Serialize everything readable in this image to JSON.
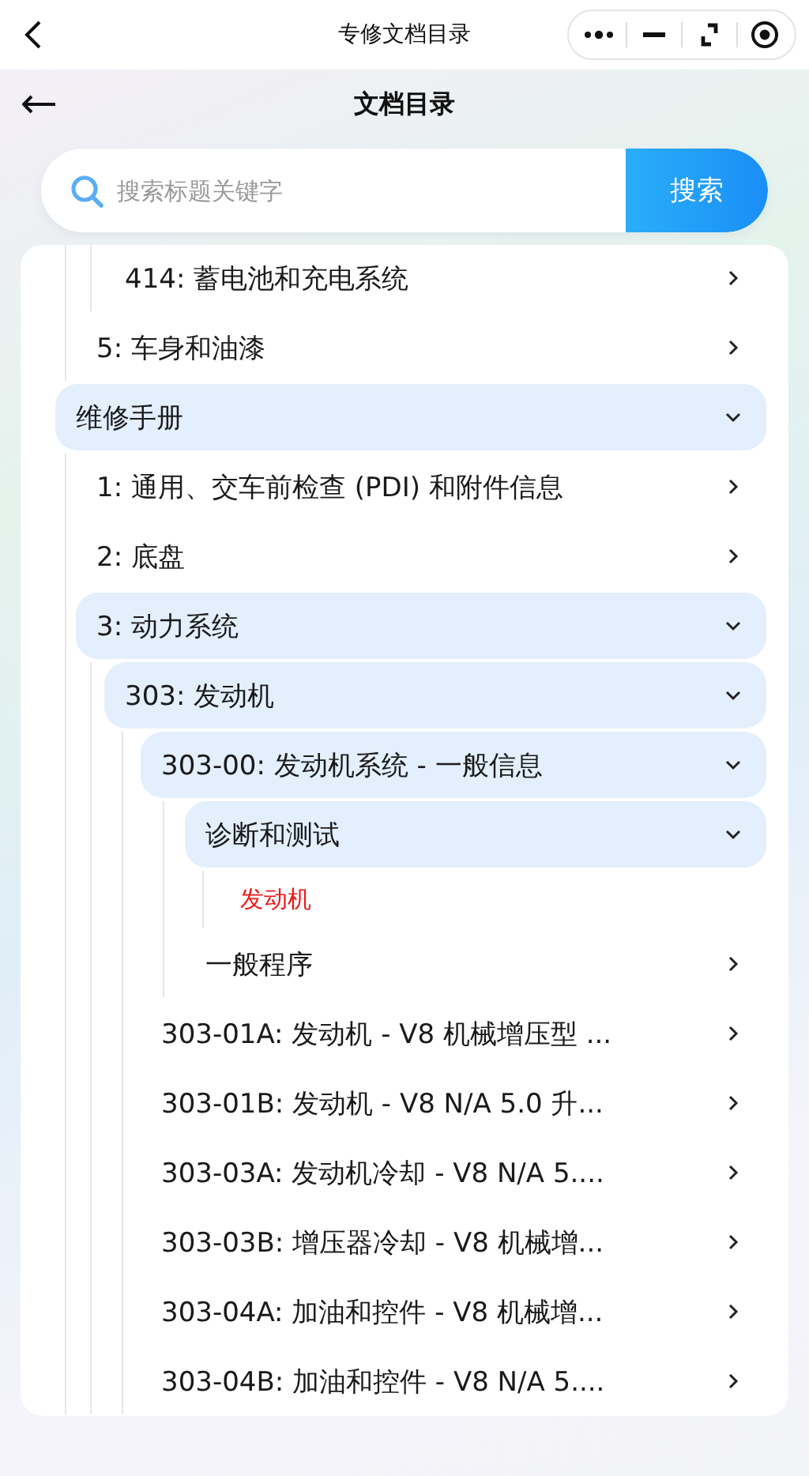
{
  "top_bar": {
    "title": "专修文档目录"
  },
  "header": {
    "title": "文档目录"
  },
  "search": {
    "placeholder": "搜索标题关键字",
    "button": "搜索"
  },
  "tree": [
    {
      "children": [
        {
          "children": [
            {
              "label": "414: 蓄电池和充电系统",
              "expanded": false,
              "selected": false
            }
          ]
        },
        {
          "label": "5: 车身和油漆",
          "expanded": false,
          "selected": false
        }
      ]
    },
    {
      "label": "维修手册",
      "expanded": true,
      "selected": false,
      "children": [
        {
          "label": "1: 通用、交车前检查 (PDI) 和附件信息",
          "expanded": false,
          "selected": false
        },
        {
          "label": "2: 底盘",
          "expanded": false,
          "selected": false
        },
        {
          "label": "3: 动力系统",
          "expanded": true,
          "selected": false,
          "children": [
            {
              "label": "303: 发动机",
              "expanded": true,
              "selected": false,
              "children": [
                {
                  "label": "303-00: 发动机系统 - 一般信息",
                  "expanded": true,
                  "selected": false,
                  "children": [
                    {
                      "label": "诊断和测试",
                      "expanded": true,
                      "selected": false,
                      "children": [
                        {
                          "label": "发动机",
                          "selected": true
                        }
                      ]
                    },
                    {
                      "label": "一般程序",
                      "expanded": false,
                      "selected": false
                    }
                  ]
                },
                {
                  "label": "303-01A: 发动机 - V8 机械增压型 ...",
                  "expanded": false,
                  "selected": false
                },
                {
                  "label": "303-01B: 发动机 - V8 N/A 5.0 升...",
                  "expanded": false,
                  "selected": false
                },
                {
                  "label": "303-03A: 发动机冷却 - V8 N/A 5....",
                  "expanded": false,
                  "selected": false
                },
                {
                  "label": "303-03B: 增压器冷却 - V8 机械增...",
                  "expanded": false,
                  "selected": false
                },
                {
                  "label": "303-04A: 加油和控件 - V8 机械增...",
                  "expanded": false,
                  "selected": false
                },
                {
                  "label": "303-04B: 加油和控件 - V8 N/A 5....",
                  "expanded": false,
                  "selected": false
                }
              ]
            }
          ]
        }
      ]
    }
  ]
}
